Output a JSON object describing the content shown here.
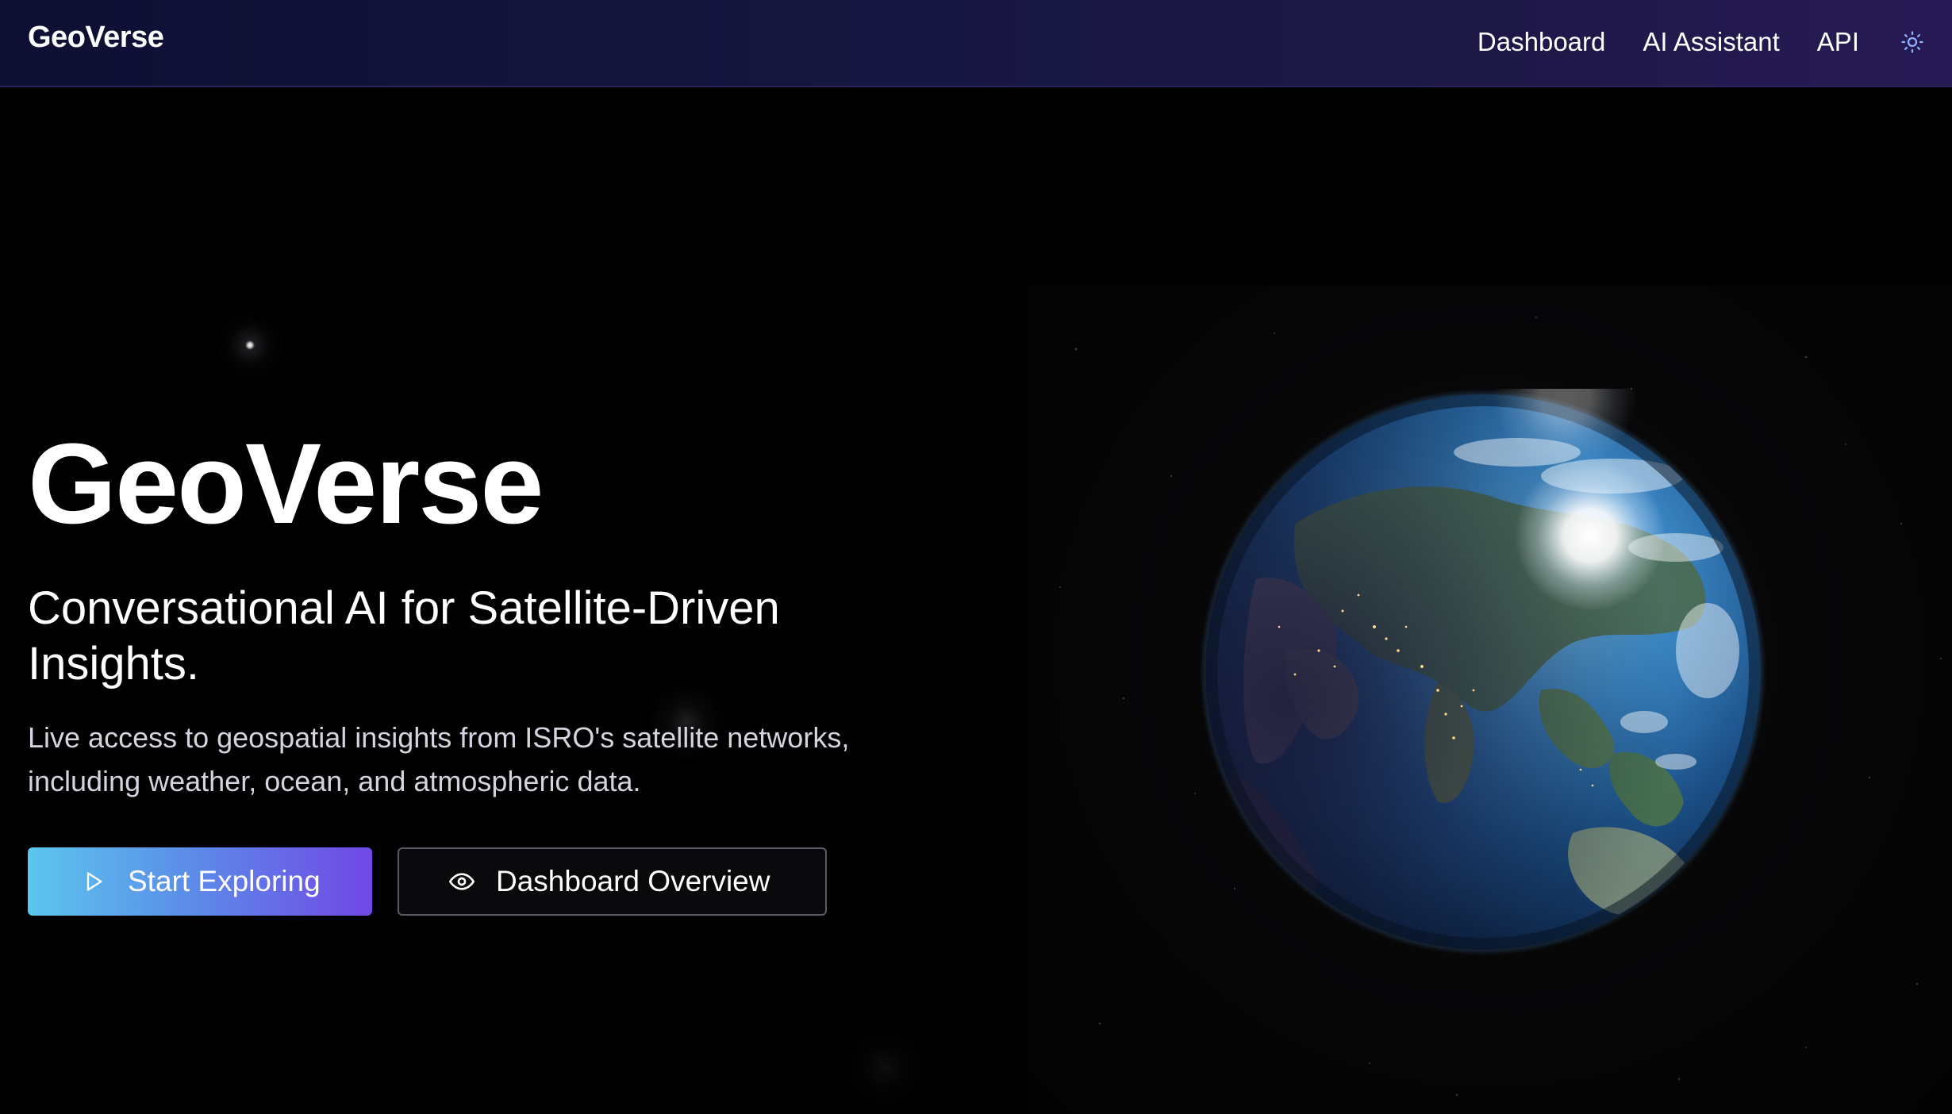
{
  "app": {
    "brand": "GeoVerse"
  },
  "nav": {
    "links": [
      {
        "label": "Dashboard"
      },
      {
        "label": "AI Assistant"
      },
      {
        "label": "API"
      }
    ],
    "theme_toggle_icon": "sun-icon"
  },
  "hero": {
    "title": "GeoVerse",
    "subtitle": "Conversational AI for Satellite-Driven Insights.",
    "description": "Live access to geospatial insights from ISRO's satellite networks, including weather, ocean, and atmospheric data."
  },
  "buttons": {
    "primary": {
      "label": "Start Exploring",
      "icon": "play-icon"
    },
    "secondary": {
      "label": "Dashboard Overview",
      "icon": "eye-icon"
    }
  },
  "colors": {
    "navbar_start": "#0d1033",
    "navbar_end": "#281a55",
    "primary_gradient_start": "#5bc7ee",
    "primary_gradient_end": "#7147e6",
    "background": "#000000"
  },
  "visual": {
    "globe": "earth-globe-image"
  }
}
